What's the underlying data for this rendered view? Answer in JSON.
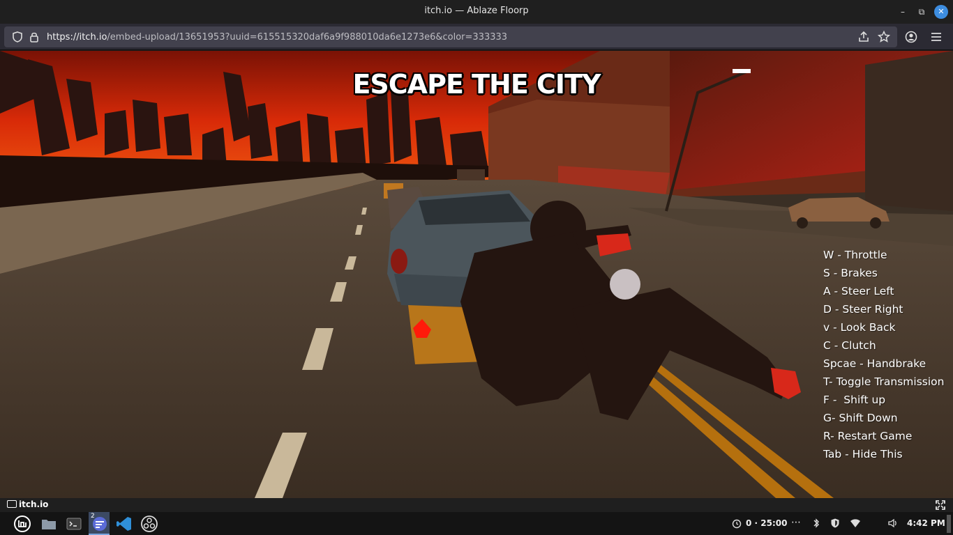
{
  "window": {
    "title": "itch.io — Ablaze Floorp",
    "minimize": "–",
    "maximize": "⧉",
    "close": "✕"
  },
  "browser": {
    "url_host": "https://itch.io",
    "url_path": "/embed-upload/13651953?uuid=615515320daf6a9f988010da6e1273e6&color=333333"
  },
  "game": {
    "title": "ESCAPE THE CITY",
    "controls": [
      "W - Throttle",
      "S - Brakes",
      "A - Steer Left",
      "D - Steer Right",
      "v - Look Back",
      "C - Clutch",
      "Spcae - Handbrake",
      "T- Toggle Transmission",
      "F -  Shift up",
      "G- Shift Down",
      "R- Restart Game",
      "Tab - Hide This"
    ]
  },
  "itch_footer": {
    "logo": "itch.io"
  },
  "taskbar": {
    "workspace_badge": "2",
    "timer": "0 · 25:00",
    "overflow": "⋯",
    "clock": "4:42 PM"
  }
}
